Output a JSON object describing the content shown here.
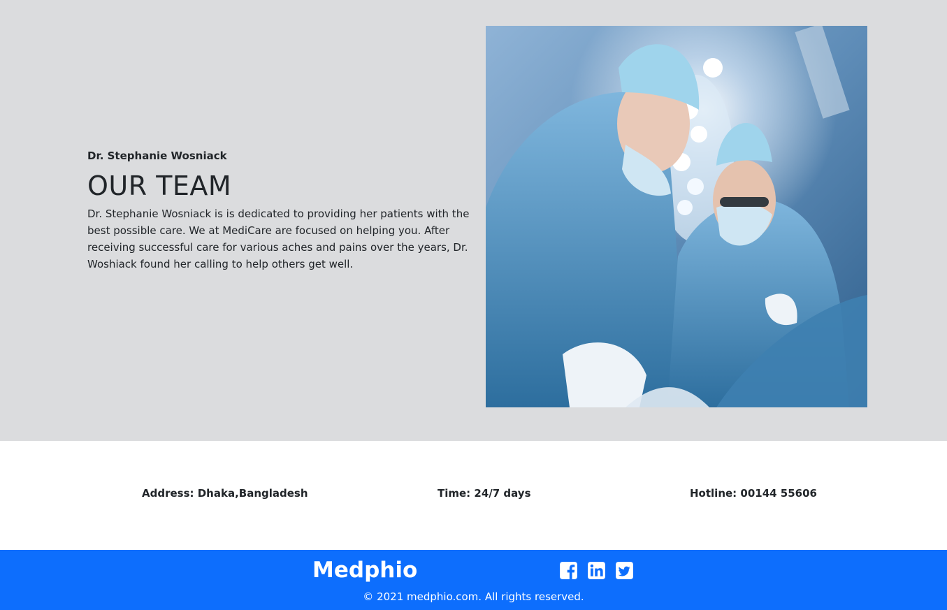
{
  "team": {
    "doctor_name": "Dr. Stephanie Wosniack",
    "title": "OUR TEAM",
    "description": "Dr. Stephanie Wosniack is is dedicated to providing her patients with the best possible care. We at MediCare are focused on helping you. After receiving successful care for various aches and pains over the years, Dr. Woshiack found her calling to help others get well.",
    "image": "surgeons-operating-photo"
  },
  "info": {
    "address": "Address: Dhaka,Bangladesh",
    "time": "Time: 24/7 days",
    "hotline": "Hotline: 00144 55606"
  },
  "footer": {
    "brand": "Medphio",
    "social_icons": [
      "facebook-icon",
      "linkedin-icon",
      "twitter-icon"
    ],
    "copyright": "© 2021 medphio.com. All rights reserved."
  },
  "colors": {
    "team_background": "#dbdcde",
    "footer_background": "#0d6efd",
    "text": "#212529"
  }
}
